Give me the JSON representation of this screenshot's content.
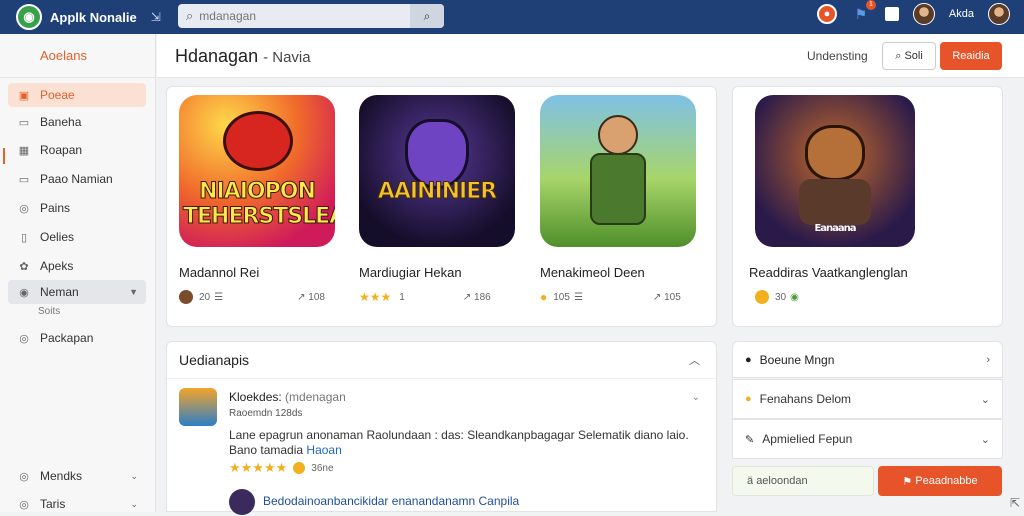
{
  "topbar": {
    "app_title": "Applk Nonalie",
    "expand_glyph": "⇲",
    "search_placeholder": "mdanagan",
    "notif_count": "1",
    "user_name": "Akda",
    "icons": [
      "app-logo-icon",
      "expand-icon",
      "search-icon",
      "notification-icon",
      "bell-icon",
      "window-icon",
      "avatar",
      "user-avatar"
    ]
  },
  "sidebar": {
    "header": "Aoelans",
    "items": [
      {
        "label": "Poeae",
        "icon": "home-icon",
        "state": "active"
      },
      {
        "label": "Baneha",
        "icon": "list-icon"
      },
      {
        "label": "Roapan",
        "icon": "grid-icon"
      },
      {
        "label": "Paao Namian",
        "icon": "chat-icon"
      },
      {
        "label": "Pains",
        "icon": "settings-icon"
      },
      {
        "label": "Oelies",
        "icon": "file-icon"
      },
      {
        "label": "Apeks",
        "icon": "puzzle-icon"
      },
      {
        "label": "Neman",
        "icon": "gear-icon",
        "state": "selected"
      },
      {
        "label": "Packapan",
        "icon": "help-icon"
      },
      {
        "label": "Mendks",
        "icon": "menu-icon"
      },
      {
        "label": "Taris",
        "icon": "tag-icon"
      }
    ],
    "sub_label": "Soits"
  },
  "header": {
    "title": "Hdanagan",
    "subtitle": "- Navia",
    "link": "Undensting",
    "outline_button": "Soli",
    "primary_button": "Reaidia"
  },
  "games": [
    {
      "title": "Madannol Rei",
      "art_text": "NIAIOPON TEHERSTSLEAI",
      "meta_left": "20",
      "meta_right": "108",
      "stars": 0,
      "colors": [
        "#f7c020",
        "#e0284a"
      ]
    },
    {
      "title": "Mardiugiar Hekan",
      "art_text": "AAININIER",
      "meta_left": "1",
      "meta_right": "186",
      "stars": 3,
      "colors": [
        "#1c1438",
        "#6e4ab8"
      ]
    },
    {
      "title": "Menakimeol Deen",
      "art_text": "",
      "meta_left": "105",
      "meta_right": "105",
      "stars": 0,
      "colors": [
        "#7fbf3a",
        "#3a7fbf"
      ]
    },
    {
      "title": "Readdiras Vaatkanglenglan",
      "art_text": "Eanaana",
      "meta_left": "30",
      "meta_right": "",
      "stars": 0,
      "colors": [
        "#2a1a4a",
        "#d97a2a"
      ]
    }
  ],
  "reviews": {
    "heading": "Uedianapis",
    "author": "Kloekdes:",
    "author_tag": "(mdenagan",
    "date": "Raoemdn 128ds",
    "text": "Lane epagrun anonaman Raolundaan : das: Sleandkanpbagagar Selematik diano laio.",
    "text_line2": "Bano tamadia",
    "text_link": "Haoan",
    "rating": 5,
    "rating_count": "36ne",
    "reply_text": "Bedodainoanbancikidar enanandanamn Canpila"
  },
  "accordion": {
    "a1": "Boeune Mngn",
    "a2": "Fenahans Delom",
    "a3": "Apmielied Fepun",
    "input_text": "aeloondan",
    "button": "Peaadnabbe"
  }
}
